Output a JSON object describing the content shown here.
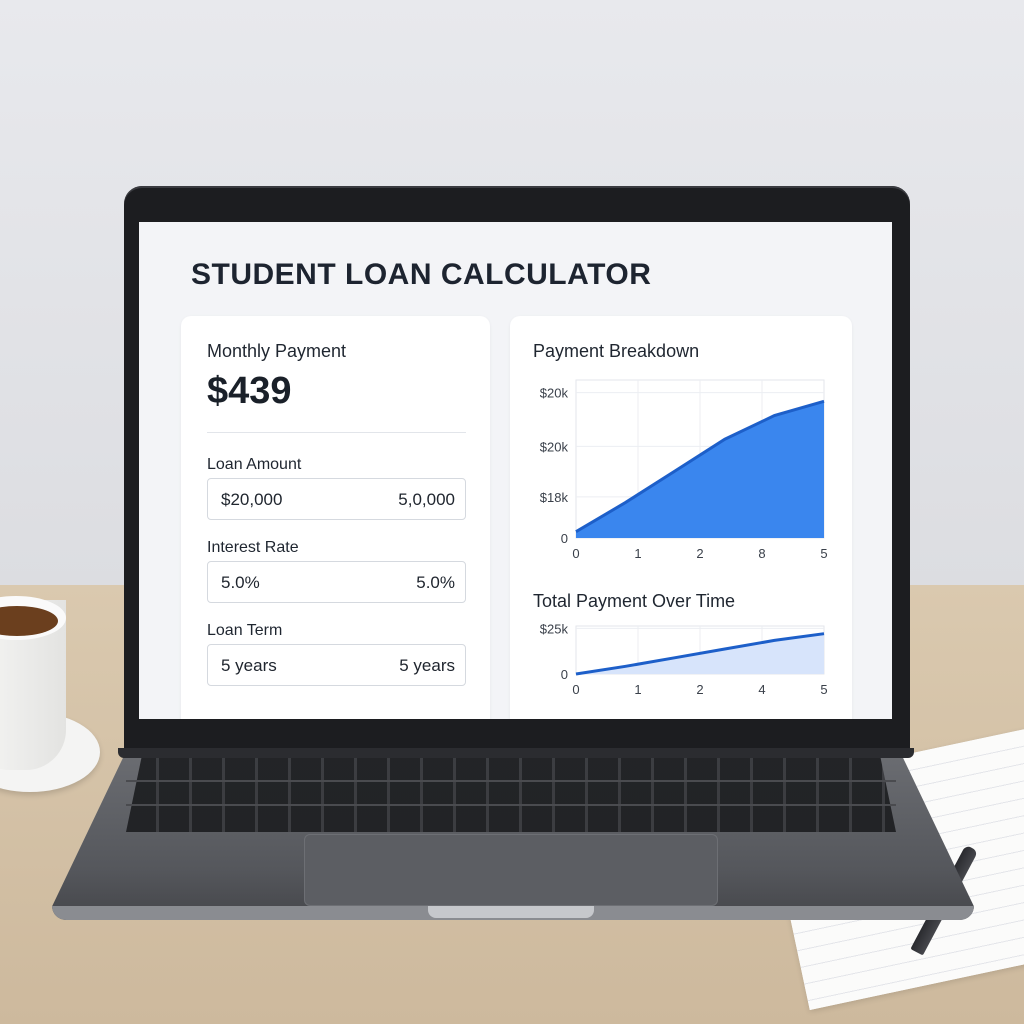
{
  "app": {
    "title": "STUDENT LOAN CALCULATOR"
  },
  "summary": {
    "label": "Monthly Payment",
    "value": "$439"
  },
  "inputs": [
    {
      "label": "Loan Amount",
      "value": "$20,000",
      "secondary": "5,0,000"
    },
    {
      "label": "Interest Rate",
      "value": "5.0%",
      "secondary": "5.0%"
    },
    {
      "label": "Loan Term",
      "value": "5 years",
      "secondary": "5 years"
    }
  ],
  "chart_data": [
    {
      "type": "area",
      "title": "Payment Breakdown",
      "x": [
        0,
        1,
        2,
        3,
        4,
        5
      ],
      "x_tick_labels": [
        "0",
        "1",
        "2",
        "8",
        "5"
      ],
      "y_tick_labels": [
        "$20k",
        "$20k",
        "$18k",
        "0"
      ],
      "series": [
        {
          "values": [
            0.8,
            4.5,
            8.5,
            12.5,
            15.5,
            17.3
          ]
        }
      ],
      "ylim": [
        0,
        20
      ],
      "grid": true,
      "colors": {
        "fill": "#3a86ee",
        "line": "#1d5fc9"
      }
    },
    {
      "type": "area",
      "title": "Total Payment Over Time",
      "x": [
        0,
        1,
        2,
        3,
        4,
        5
      ],
      "x_tick_labels": [
        "0",
        "1",
        "2",
        "4",
        "5"
      ],
      "y_tick_labels": [
        "$25k",
        "0"
      ],
      "series": [
        {
          "values": [
            0,
            4,
            8.5,
            13,
            17.5,
            21
          ]
        }
      ],
      "ylim": [
        0,
        25
      ],
      "grid": true,
      "colors": {
        "fill": "#d7e4fb",
        "line": "#1d5fc9"
      }
    }
  ]
}
